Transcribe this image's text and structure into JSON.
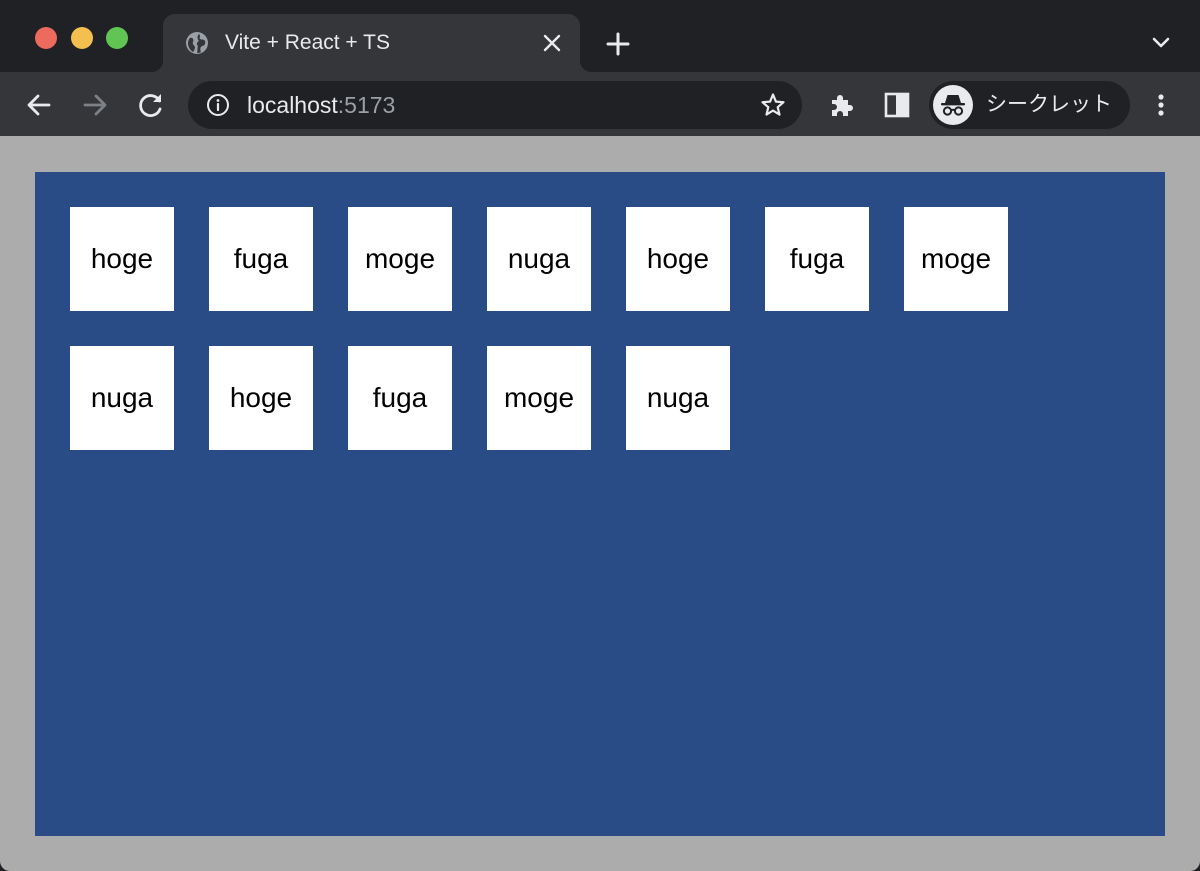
{
  "browser": {
    "tab": {
      "title": "Vite + React + TS",
      "favicon": "globe-icon",
      "close_icon": "close-icon"
    },
    "new_tab_icon": "plus-icon",
    "tab_list_icon": "chevron-down-icon",
    "toolbar": {
      "back_icon": "arrow-left-icon",
      "forward_icon": "arrow-right-icon",
      "reload_icon": "reload-icon",
      "address": {
        "host": "localhost",
        "port": ":5173",
        "info_icon": "info-icon",
        "bookmark_icon": "star-icon"
      },
      "extensions_icon": "puzzle-icon",
      "side_panel_icon": "side-panel-icon",
      "profile": {
        "label": "シークレット",
        "icon": "incognito-icon"
      },
      "menu_icon": "more-vert-icon"
    },
    "colors": {
      "frame": "#202124",
      "toolbar": "#35363a",
      "text": "#e8eaed",
      "muted": "#9aa0a6"
    }
  },
  "page": {
    "colors": {
      "background": "#acacac",
      "container": "#294c86",
      "card": "#ffffff"
    },
    "cards": [
      "hoge",
      "fuga",
      "moge",
      "nuga",
      "hoge",
      "fuga",
      "moge",
      "nuga",
      "hoge",
      "fuga",
      "moge",
      "nuga"
    ]
  }
}
